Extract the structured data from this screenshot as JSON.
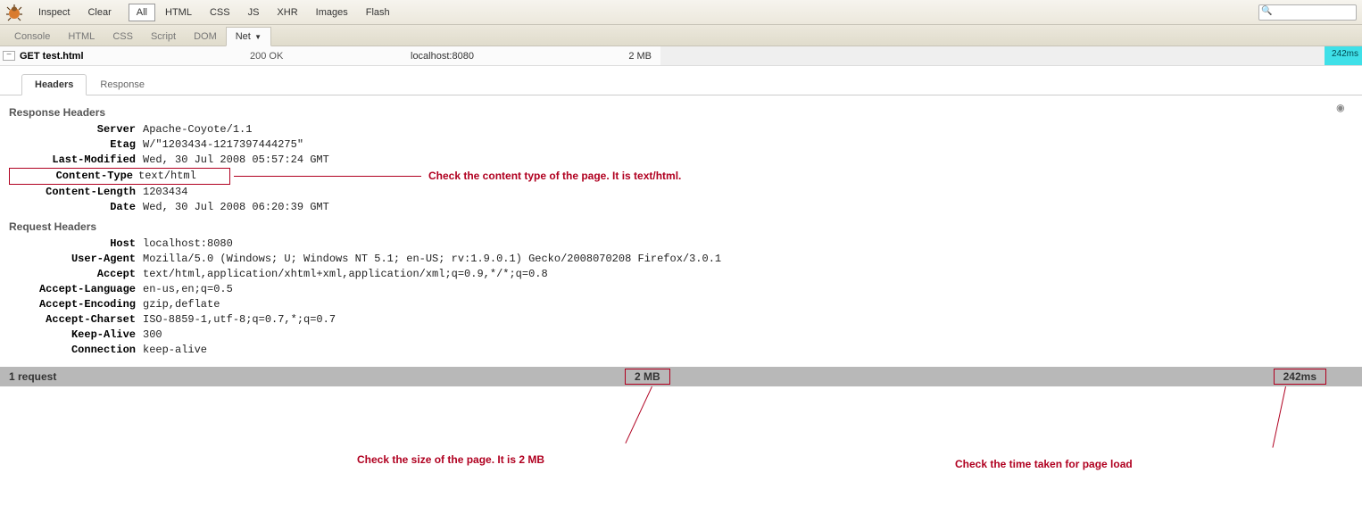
{
  "toolbar": {
    "inspect": "Inspect",
    "clear": "Clear",
    "filters": [
      "All",
      "HTML",
      "CSS",
      "JS",
      "XHR",
      "Images",
      "Flash"
    ],
    "active_filter": "All",
    "search_placeholder": ""
  },
  "subtabs": {
    "items": [
      "Console",
      "HTML",
      "CSS",
      "Script",
      "DOM",
      "Net"
    ],
    "active": "Net"
  },
  "request": {
    "method_url": "GET test.html",
    "status": "200 OK",
    "domain": "localhost:8080",
    "size": "2 MB",
    "time": "242ms"
  },
  "inner_tabs": {
    "items": [
      "Headers",
      "Response"
    ],
    "active": "Headers"
  },
  "response_headers_title": "Response Headers",
  "response_headers": [
    {
      "name": "Server",
      "value": "Apache-Coyote/1.1"
    },
    {
      "name": "Etag",
      "value": "W/\"1203434-1217397444275\""
    },
    {
      "name": "Last-Modified",
      "value": "Wed, 30 Jul 2008 05:57:24 GMT"
    },
    {
      "name": "Content-Type",
      "value": "text/html"
    },
    {
      "name": "Content-Length",
      "value": "1203434"
    },
    {
      "name": "Date",
      "value": "Wed, 30 Jul 2008 06:20:39 GMT"
    }
  ],
  "request_headers_title": "Request Headers",
  "request_headers": [
    {
      "name": "Host",
      "value": "localhost:8080"
    },
    {
      "name": "User-Agent",
      "value": "Mozilla/5.0 (Windows; U; Windows NT 5.1; en-US; rv:1.9.0.1) Gecko/2008070208 Firefox/3.0.1"
    },
    {
      "name": "Accept",
      "value": "text/html,application/xhtml+xml,application/xml;q=0.9,*/*;q=0.8"
    },
    {
      "name": "Accept-Language",
      "value": "en-us,en;q=0.5"
    },
    {
      "name": "Accept-Encoding",
      "value": "gzip,deflate"
    },
    {
      "name": "Accept-Charset",
      "value": "ISO-8859-1,utf-8;q=0.7,*;q=0.7"
    },
    {
      "name": "Keep-Alive",
      "value": "300"
    },
    {
      "name": "Connection",
      "value": "keep-alive"
    }
  ],
  "summary": {
    "requests": "1 request",
    "size": "2 MB",
    "time": "242ms"
  },
  "annotations": {
    "content_type": "Check the content type of the page. It is text/html.",
    "size": "Check the size of the page. It is 2 MB",
    "time": "Check the time taken for page load"
  }
}
